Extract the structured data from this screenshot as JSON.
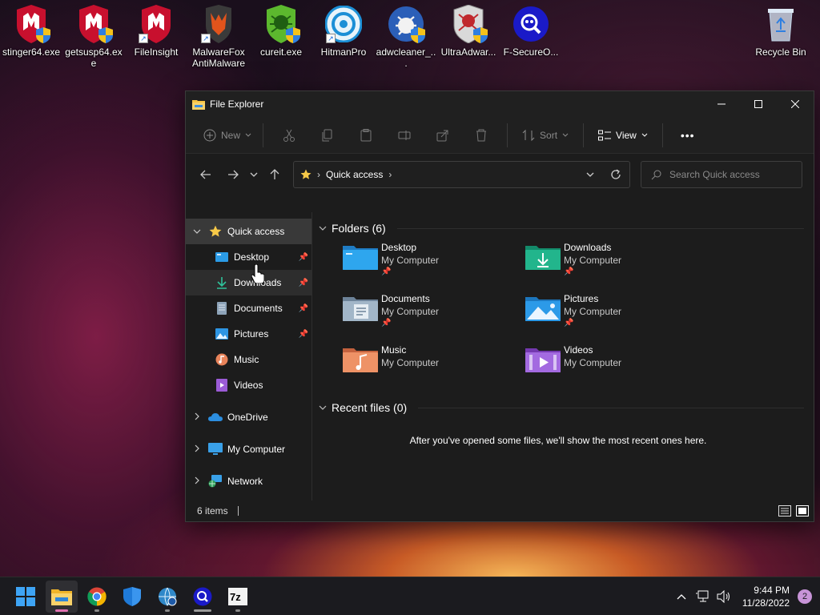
{
  "desktop": {
    "icons": [
      {
        "label": "stinger64.exe",
        "icon": "mcafee-shield-icon"
      },
      {
        "label": "getsusp64.exe",
        "icon": "mcafee-shield-icon"
      },
      {
        "label": "FileInsight",
        "icon": "mcafee-shield-icon"
      },
      {
        "label": "MalwareFox AntiMalware",
        "icon": "malwarefox-icon"
      },
      {
        "label": "cureit.exe",
        "icon": "drweb-spider-icon"
      },
      {
        "label": "HitmanPro",
        "icon": "hitmanpro-icon"
      },
      {
        "label": "adwcleaner_...",
        "icon": "adwcleaner-icon"
      },
      {
        "label": "UltraAdwar...",
        "icon": "ultraadware-icon"
      },
      {
        "label": "F-SecureO...",
        "icon": "fsecure-icon"
      },
      {
        "label": "Recycle Bin",
        "icon": "recycle-bin-icon"
      }
    ]
  },
  "window": {
    "title": "File Explorer",
    "toolbar": {
      "new_label": "New",
      "sort_label": "Sort",
      "view_label": "View",
      "more_label": "•••"
    },
    "address": {
      "crumb": "Quick access"
    },
    "search": {
      "placeholder": "Search Quick access"
    },
    "sidebar": {
      "quick_access": "Quick access",
      "pinned": [
        {
          "label": "Desktop",
          "icon": "desktop-folder-icon"
        },
        {
          "label": "Downloads",
          "icon": "download-icon"
        },
        {
          "label": "Documents",
          "icon": "documents-icon"
        },
        {
          "label": "Pictures",
          "icon": "pictures-icon"
        },
        {
          "label": "Music",
          "icon": "music-icon"
        },
        {
          "label": "Videos",
          "icon": "videos-icon"
        }
      ],
      "locations": [
        {
          "label": "OneDrive",
          "icon": "onedrive-icon"
        },
        {
          "label": "My Computer",
          "icon": "computer-icon"
        },
        {
          "label": "Network",
          "icon": "network-icon"
        }
      ]
    },
    "folders_header": "Folders (6)",
    "folders": [
      {
        "name": "Desktop",
        "location": "My Computer",
        "pinned": true,
        "color": "#2b9be6"
      },
      {
        "name": "Downloads",
        "location": "My Computer",
        "pinned": true,
        "color": "#21a883"
      },
      {
        "name": "Documents",
        "location": "My Computer",
        "pinned": true,
        "color": "#8da3b8"
      },
      {
        "name": "Pictures",
        "location": "My Computer",
        "pinned": true,
        "color": "#2d95e3"
      },
      {
        "name": "Music",
        "location": "My Computer",
        "pinned": false,
        "color": "#e8835a"
      },
      {
        "name": "Videos",
        "location": "My Computer",
        "pinned": false,
        "color": "#9b5bd6"
      }
    ],
    "recent_header": "Recent files (0)",
    "recent_message": "After you've opened some files, we'll show the most recent ones here.",
    "status": {
      "item_count": "6 items"
    }
  },
  "taskbar": {
    "apps": [
      "start-icon",
      "file-explorer-icon",
      "chrome-icon",
      "defender-shield-icon",
      "network-globe-icon",
      "fsecure-search-icon",
      "7zip-icon"
    ],
    "time": "9:44 PM",
    "date": "11/28/2022",
    "notification_count": "2"
  }
}
